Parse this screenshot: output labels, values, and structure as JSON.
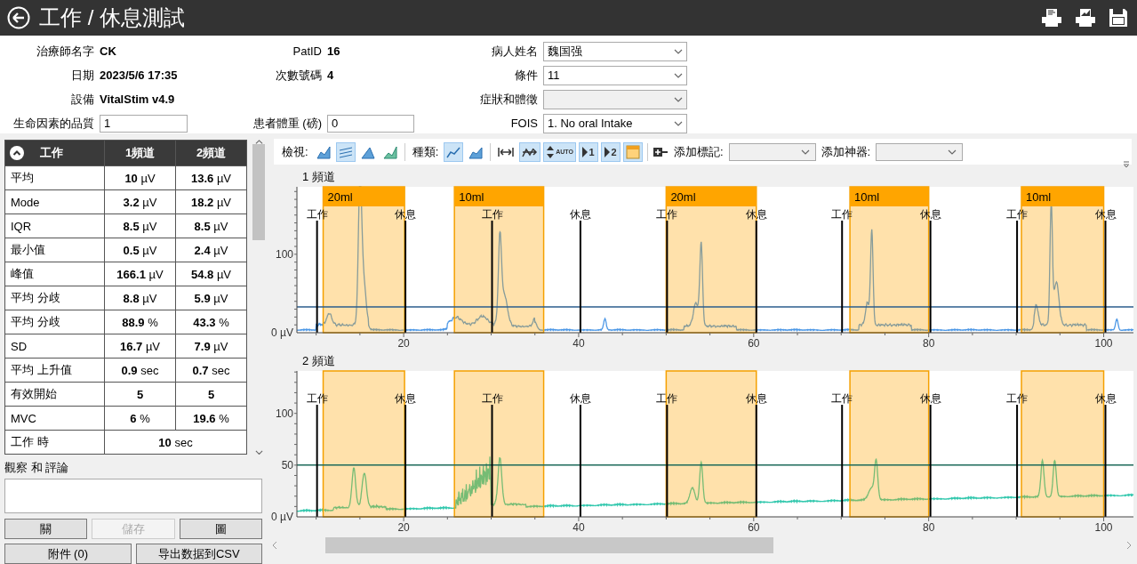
{
  "header": {
    "title": "工作 / 休息測試"
  },
  "info": {
    "rows": [
      [
        {
          "kind": "text",
          "label": "治療師名字",
          "value": "CK"
        },
        {
          "kind": "text",
          "label": "PatID",
          "value": "16"
        },
        {
          "kind": "select",
          "label": "病人姓名",
          "value": "魏国强"
        }
      ],
      [
        {
          "kind": "text",
          "label": "日期",
          "value": "2023/5/6 17:35"
        },
        {
          "kind": "text",
          "label": "次數號碼",
          "value": "4"
        },
        {
          "kind": "select",
          "label": "條件",
          "value": "11"
        }
      ],
      [
        {
          "kind": "text",
          "label": "設備",
          "value": "VitalStim v4.9"
        },
        null,
        {
          "kind": "select",
          "label": "症狀和體徵"
        }
      ],
      [
        {
          "kind": "input",
          "label": "生命因素的品質",
          "value": "1"
        },
        {
          "kind": "input",
          "label": "患者體重 (磅)",
          "value": "0"
        },
        {
          "kind": "select",
          "label": "FOIS",
          "value": "1. No oral Intake"
        }
      ]
    ]
  },
  "table": {
    "expanded": true,
    "columns": [
      "工作",
      "1頻道",
      "2頻道"
    ],
    "rows": [
      {
        "label": "平均",
        "values": [
          "**10** µV",
          "**13.6** µV"
        ]
      },
      {
        "label": "Mode",
        "values": [
          "**3.2** µV",
          "**18.2** µV"
        ]
      },
      {
        "label": "IQR",
        "values": [
          "**8.5** µV",
          "**8.5** µV"
        ]
      },
      {
        "label": "最小值",
        "values": [
          "**0.5** µV",
          "**2.4** µV"
        ]
      },
      {
        "label": "峰值",
        "values": [
          "**166.1** µV",
          "**54.8** µV"
        ]
      },
      {
        "label": "平均 分歧",
        "values": [
          "**8.8** µV",
          "**5.9** µV"
        ]
      },
      {
        "label": "平均 分歧",
        "values": [
          "**88.9** %",
          "**43.3** %"
        ]
      },
      {
        "label": "SD",
        "values": [
          "**16.7** µV",
          "**7.9** µV"
        ]
      },
      {
        "label": "平均 上升值",
        "values": [
          "**0.9** sec",
          "**0.7** sec"
        ]
      },
      {
        "label": "有效開始",
        "values": [
          "**5**",
          "**5**"
        ]
      },
      {
        "label": "MVC",
        "values": [
          "**6** %",
          "**19.6** %"
        ]
      },
      {
        "label": "工作 時",
        "values": [
          "**10** sec"
        ]
      }
    ]
  },
  "comments": {
    "label": "觀察 和 評論"
  },
  "buttons": [
    [
      {
        "label": "關",
        "disabled": false
      },
      {
        "label": "儲存",
        "disabled": true
      },
      {
        "label": "圖",
        "disabled": false
      }
    ],
    [
      {
        "label": "附件 (0)",
        "disabled": false
      },
      {
        "label": "导出数据到CSV",
        "disabled": false
      }
    ]
  ],
  "toolbar": {
    "view_label": "檢視:",
    "view_buttons": [
      {
        "selected": false
      },
      {
        "selected": true
      },
      {
        "selected": false
      },
      {
        "selected": false
      }
    ],
    "type_label": "種類:",
    "type_buttons": [
      {
        "selected": true
      },
      {
        "selected": false
      }
    ],
    "range_buttons": [
      {
        "selected": false
      },
      {
        "selected": true
      },
      {
        "selected": true,
        "text": "AUTO"
      },
      {
        "selected": true,
        "text": "1"
      },
      {
        "selected": true,
        "text": "2"
      },
      {
        "selected": true
      }
    ],
    "marker_label": "添加標記:",
    "artifact_label": "添加神器:"
  },
  "charts": [
    {
      "title": "1 頻道",
      "y_axis_labels": [
        "100",
        "0 µV"
      ],
      "x_axis_labels": [
        "20",
        "40",
        "60",
        "80",
        "100"
      ],
      "regions": [
        {
          "label": "20ml"
        },
        {
          "label": "10ml"
        },
        {
          "label": "20ml"
        },
        {
          "label": "10ml"
        },
        {
          "label": "10ml"
        }
      ],
      "markers": [
        {
          "label": "工作"
        },
        {
          "label": "休息"
        },
        {
          "label": "工作"
        },
        {
          "label": "休息"
        },
        {
          "label": "工作"
        },
        {
          "label": "休息"
        },
        {
          "label": "工作"
        },
        {
          "label": "休息"
        },
        {
          "label": "工作"
        },
        {
          "label": "休息"
        }
      ]
    },
    {
      "title": "2 頻道",
      "y_axis_labels": [
        "100",
        "50",
        "0 µV"
      ],
      "x_axis_labels": [
        "20",
        "40",
        "60",
        "80",
        "100"
      ],
      "markers": [
        {
          "label": "工作"
        },
        {
          "label": "休息"
        },
        {
          "label": "工作"
        },
        {
          "label": "休息"
        },
        {
          "label": "工作"
        },
        {
          "label": "休息"
        },
        {
          "label": "工作"
        },
        {
          "label": "休息"
        },
        {
          "label": "工作"
        },
        {
          "label": "休息"
        }
      ]
    }
  ]
}
